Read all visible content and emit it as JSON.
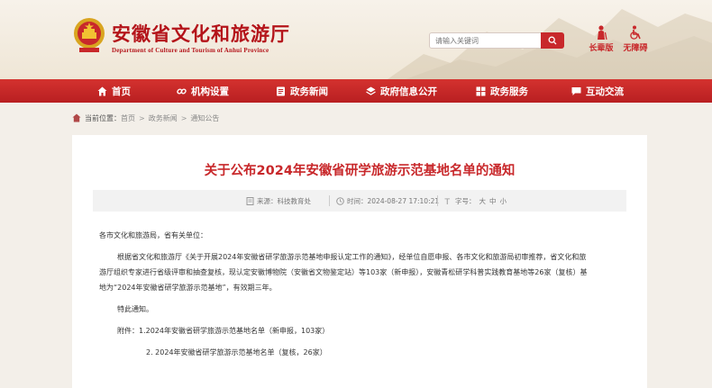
{
  "header": {
    "site_title": "安徽省文化和旅游厅",
    "site_subtitle": "Department of Culture and Tourism of Anhui Province",
    "search_placeholder": "请输入关键词",
    "tools": [
      {
        "label": "长辈版",
        "icon": "elder-icon"
      },
      {
        "label": "无障碍",
        "icon": "accessibility-icon"
      }
    ]
  },
  "nav": {
    "items": [
      {
        "label": "首页",
        "icon": "home-icon"
      },
      {
        "label": "机构设置",
        "icon": "link-icon"
      },
      {
        "label": "政务新闻",
        "icon": "news-icon"
      },
      {
        "label": "政府信息公开",
        "icon": "layers-icon"
      },
      {
        "label": "政务服务",
        "icon": "service-icon"
      },
      {
        "label": "互动交流",
        "icon": "chat-icon"
      }
    ]
  },
  "breadcrumb": {
    "here_label": "当前位置：",
    "items": [
      "首页",
      "政务新闻",
      "通知公告"
    ]
  },
  "article": {
    "title": "关于公布2024年安徽省研学旅游示范基地名单的通知",
    "source": "来源：科技教育处",
    "time": "时间：2024-08-27 17:10:21",
    "font_size_label": "字号：",
    "font_sizes": [
      "大",
      "中",
      "小"
    ],
    "salutation": "各市文化和旅游局，省有关单位：",
    "para1_line1": "根据省文化和旅游厅《关于开展2024年安徽省研学旅游示范基地申报认定工作的通知》，经单位自愿申报、各市文化和旅游局初审推荐，省文化和旅",
    "para1_line2": "游厅组织专家进行省级评审和抽查复核，现认定安徽博物院（安徽省文物鉴定站）等103家（新申报），安徽青松研学科普实践教育基地等26家（复核）基",
    "para1_line3": "地为“2024年安徽省研学旅游示范基地”，有效期三年。",
    "notice": "特此通知。",
    "attachment1": "附件：1.2024年安徽省研学旅游示范基地名单（新申报，103家）",
    "attachment2": "2. 2024年安徽省研学旅游示范基地名单（复核，26家）"
  },
  "colors": {
    "brand_red": "#c8282b",
    "nav_red": "#c4282a",
    "page_bg": "#f3efe9"
  }
}
